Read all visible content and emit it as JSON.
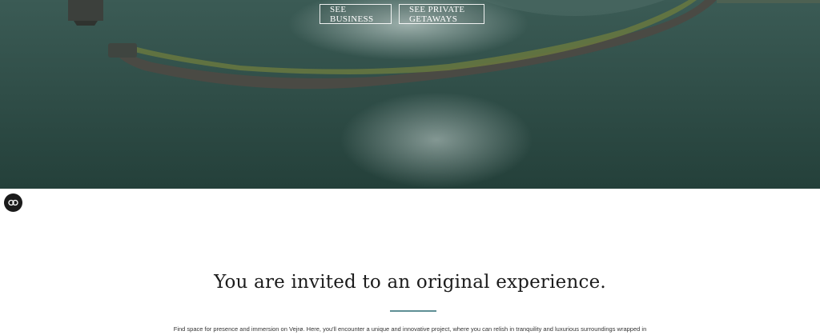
{
  "hero": {
    "buttons": {
      "business": "SEE BUSINESS",
      "private_getaways": "SEE PRIVATE GETAWAYS"
    }
  },
  "cookie_badge": {
    "icon": "cookie-consent-icon"
  },
  "intro": {
    "title": "You are invited to an original experience.",
    "text": "Find space for presence and immersion on Vejrø. Here, you'll encounter a unique and innovative project, where you can relish in tranquility and luxurious surroundings wrapped in"
  },
  "colors": {
    "water": "#2c4a44",
    "divider": "#5e8f95",
    "title": "#1c1c1c",
    "badge": "#1b1b1b"
  }
}
